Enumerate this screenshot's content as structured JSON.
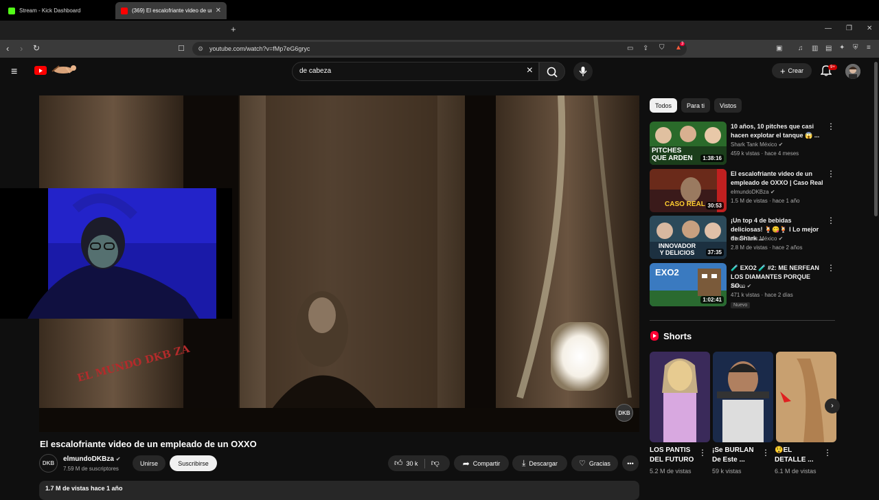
{
  "browser": {
    "tabs": [
      {
        "title": "Stream - Kick Dashboard",
        "favicon_color": "#53fc18"
      },
      {
        "title": "(369) El escalofriante video de un",
        "favicon_color": "#ff0000"
      }
    ],
    "url": "youtube.com/watch?v=fMp7eG6gryc",
    "notification_badge": "3"
  },
  "header": {
    "search_query": "de cabeza",
    "create_label": "Crear",
    "bell_badge": "9+"
  },
  "video": {
    "watermark": "EL MUNDO DKB ZA",
    "corner_logo": "DKB",
    "title": "El escalofriante video de un empleado de un OXXO",
    "channel": {
      "name": "elmundoDKBza",
      "subscribers": "7.59 M de suscriptores",
      "avatar_text": "DKB"
    },
    "actions": {
      "join": "Unirse",
      "subscribe": "Suscribirse",
      "likes": "30 k",
      "share": "Compartir",
      "download": "Descargar",
      "thanks": "Gracias"
    },
    "stats": "1.7 M de vistas  hace 1 año"
  },
  "filters": [
    "Todos",
    "Para ti",
    "Vistos"
  ],
  "recommendations": [
    {
      "title": "10 años, 10 pitches que casi hacen explotar el tanque 😱 ...",
      "channel": "Shark Tank México",
      "meta": "459 k vistas · hace 4 meses",
      "duration": "1:38:16",
      "thumb_text": "PITCHES QUE ARDEN",
      "is_new": false
    },
    {
      "title": "El escalofriante video de un empleado de OXXO | Caso Real",
      "channel": "elmundoDKBza",
      "meta": "1.5 M de vistas · hace 1 año",
      "duration": "30:53",
      "thumb_text": "CASO REAL",
      "is_new": false
    },
    {
      "title": "¡Un top 4 de bebidas deliciosas! 🍹😋🍹 I Lo mejor de Shark ...",
      "channel": "Shark Tank México",
      "meta": "2.8 M de vistas · hace 2 años",
      "duration": "37:35",
      "thumb_text": "INNOVADOR Y DELICIOS",
      "is_new": false
    },
    {
      "title": "🧪 EXO2 🧪 #2: ME NERFEAN LOS DIAMANTES PORQUE SO...",
      "channel": "Auron",
      "meta": "471 k vistas · hace 2 días",
      "duration": "1:02:41",
      "thumb_text": "EXO2",
      "is_new": true,
      "new_label": "Nuevo"
    }
  ],
  "shorts": {
    "heading": "Shorts",
    "items": [
      {
        "title": "LOS PANTIS DEL FUTURO",
        "views": "5.2 M de vistas"
      },
      {
        "title": "¡Se BURLAN De Este ...",
        "views": "59 k vistas"
      },
      {
        "title": "😲EL DETALLE ...",
        "views": "6.1 M de vistas"
      }
    ]
  }
}
